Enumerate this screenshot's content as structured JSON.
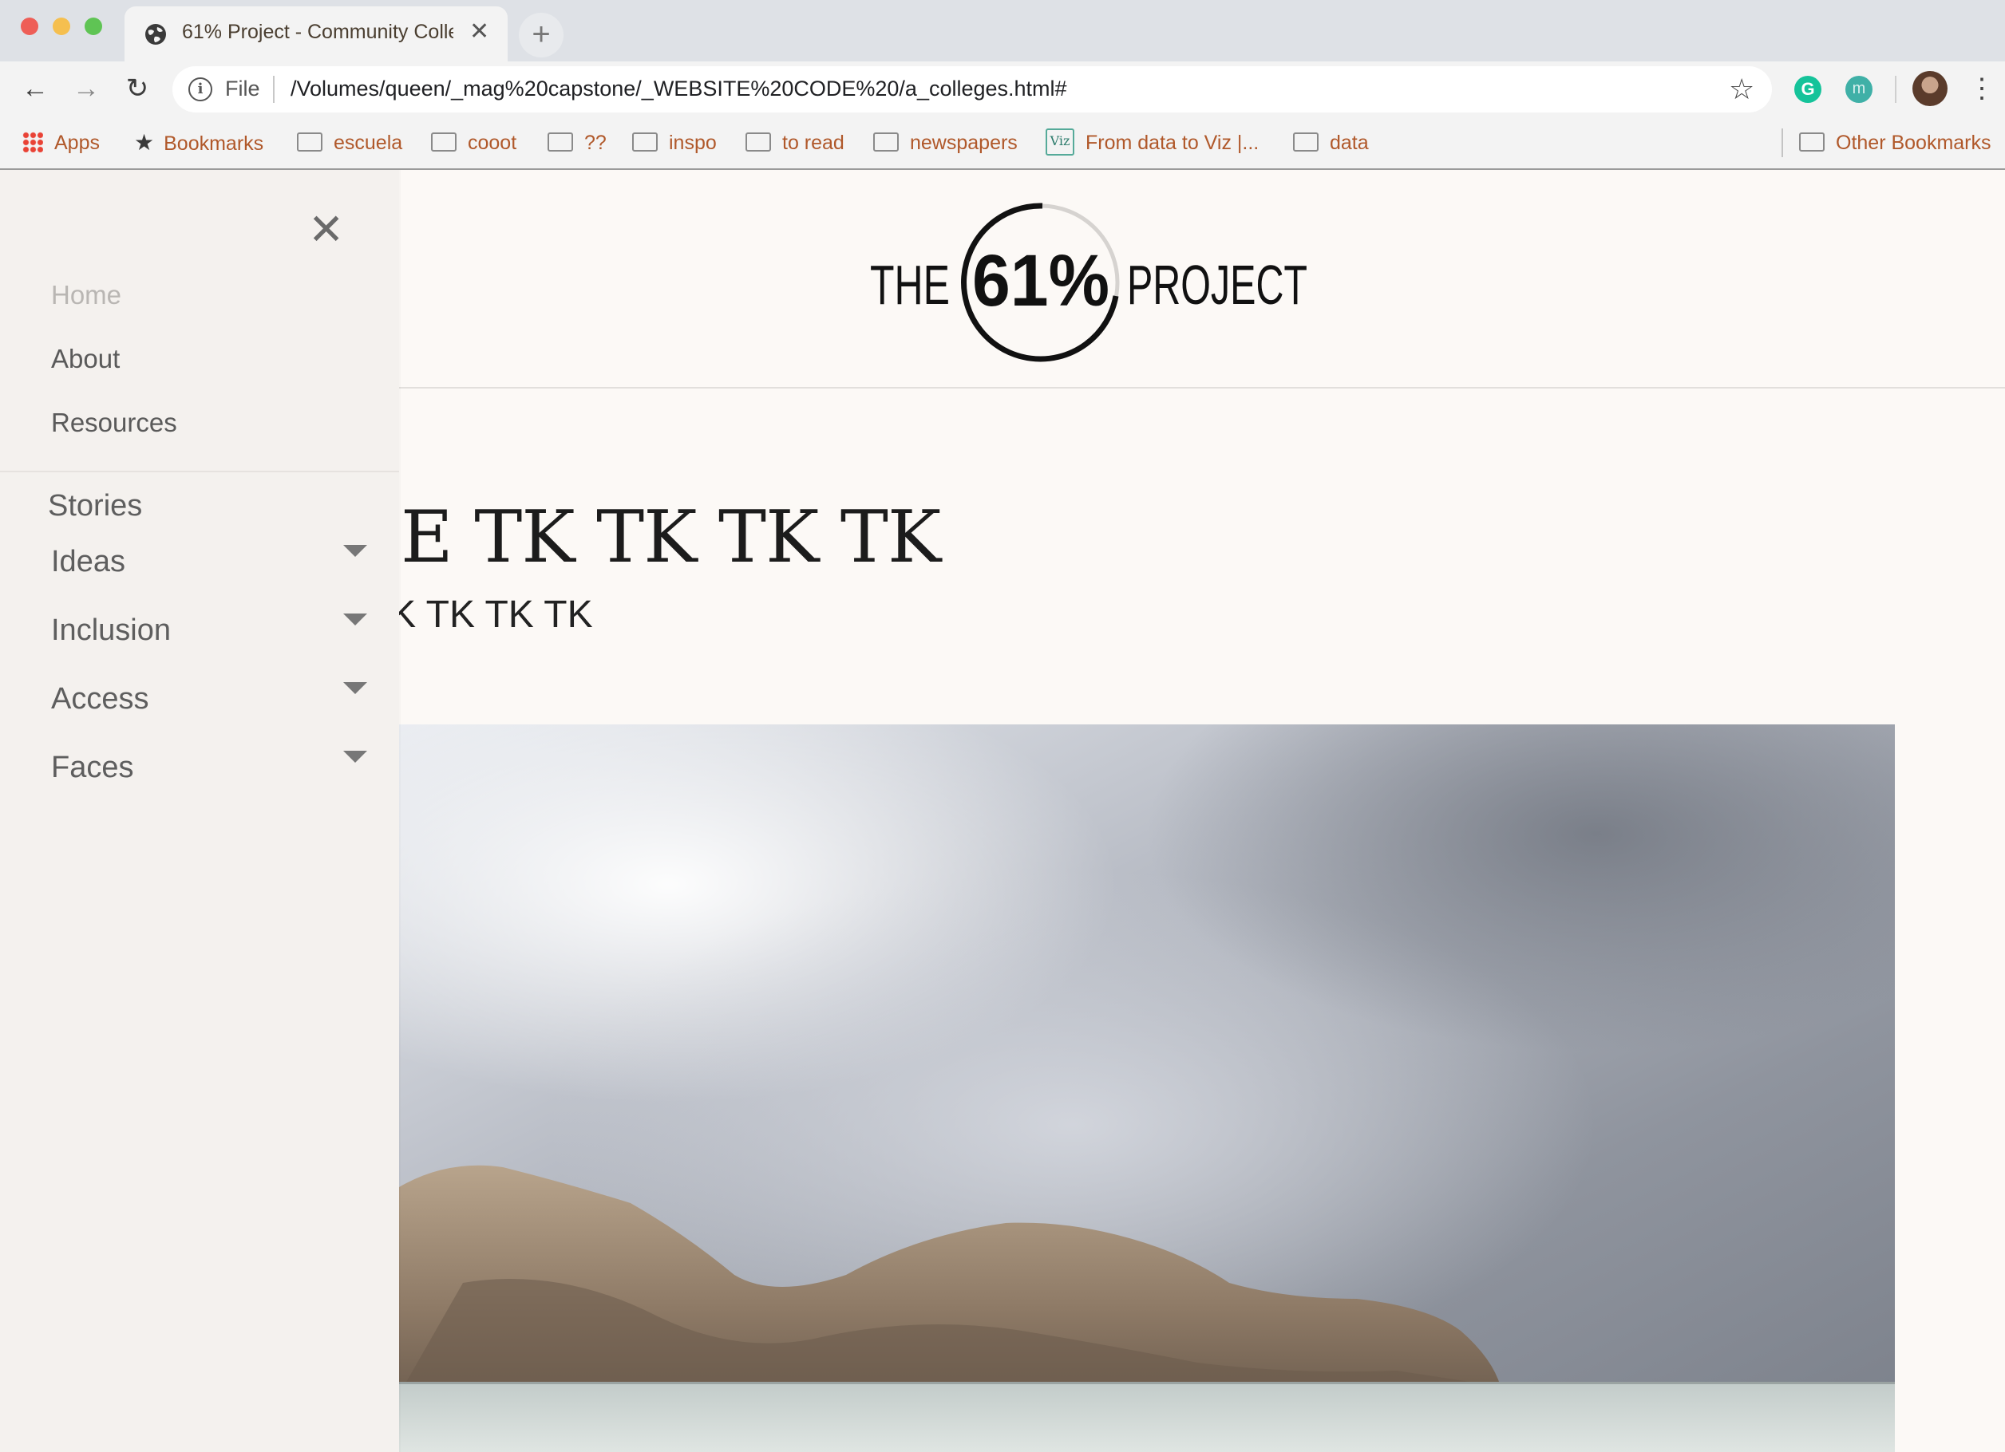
{
  "browser": {
    "tab_title": "61% Project - Community Colle",
    "tab_close": "✕",
    "new_tab": "+",
    "scheme_label": "File",
    "url": "/Volumes/queen/_mag%20capstone/_WEBSITE%20CODE%20/a_colleges.html#",
    "ext_grammarly": "G",
    "ext_m": "m"
  },
  "bookmarks": {
    "apps": "Apps",
    "bookmarks": "Bookmarks",
    "items": [
      "escuela",
      "cooot",
      "??",
      "inspo",
      "to read",
      "newspapers"
    ],
    "viz_icon": "Viz",
    "from_data": "From data to Viz |...",
    "data": "data",
    "other": "Other Bookmarks"
  },
  "logo": {
    "the": "THE",
    "number": "61%",
    "project": "PROJECT"
  },
  "article": {
    "headline": "E TK TK TK TK",
    "subhead": "'K TK TK TK"
  },
  "sidebar": {
    "close": "✕",
    "links": [
      "Home",
      "About",
      "Resources"
    ],
    "stories_heading": "Stories",
    "categories": [
      "Ideas",
      "Inclusion",
      "Access",
      "Faces"
    ]
  },
  "colors": {
    "page_bg": "#fcf9f6",
    "sidebar_bg": "#f4f1ee",
    "bookmark_text": "#b0582a"
  }
}
